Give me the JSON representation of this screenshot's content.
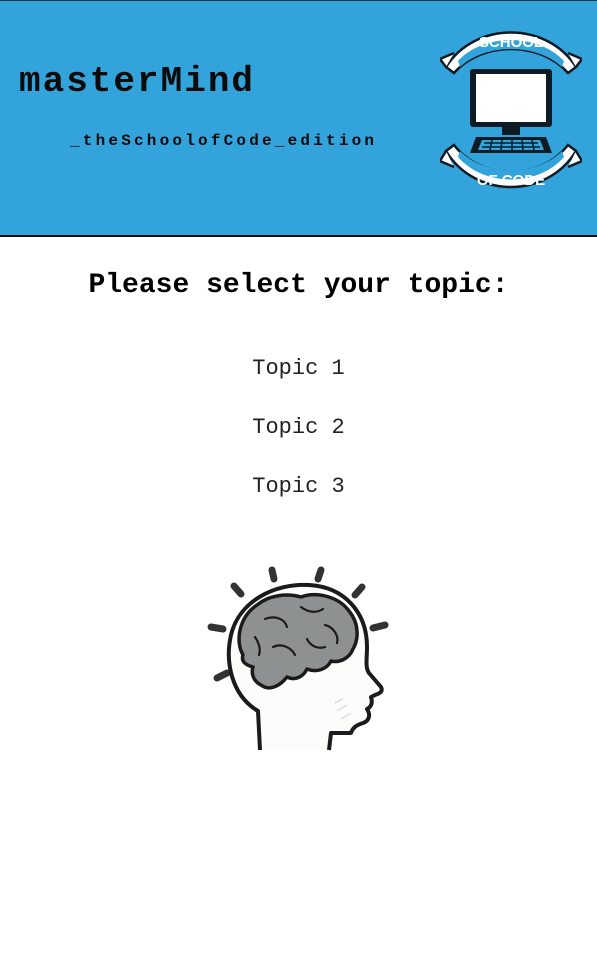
{
  "header": {
    "title": "masterMind",
    "subtitle": "_theSchoolofCode_edition",
    "background_color": "#33a3dc",
    "logo": {
      "icon": "school-of-code-logo",
      "text_top": "SCHOOL",
      "text_bottom": "OF CODE",
      "color": "#33a3dc"
    }
  },
  "main": {
    "prompt": "Please select your topic:",
    "topics": [
      {
        "label": "Topic 1"
      },
      {
        "label": "Topic 2"
      },
      {
        "label": "Topic 3"
      }
    ],
    "illustration": {
      "icon": "brain-head-icon",
      "brain_color": "#8e9192"
    }
  }
}
